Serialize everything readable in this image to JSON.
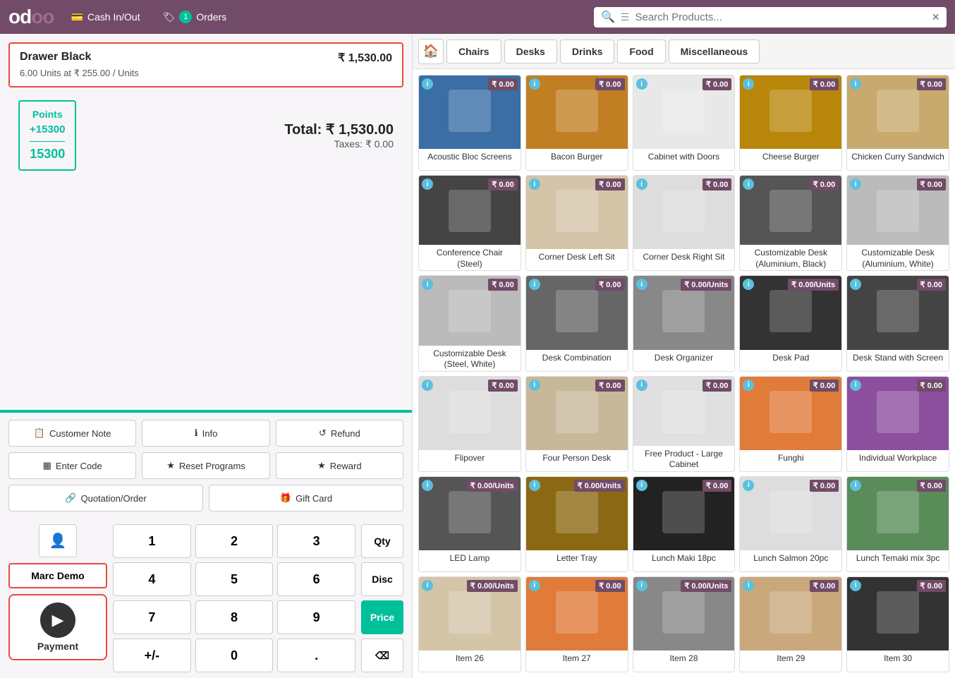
{
  "topbar": {
    "logo": "odoo",
    "cash_btn": "Cash In/Out",
    "orders_btn": "Orders",
    "orders_count": "1",
    "search_placeholder": "Search Products...",
    "search_clear": "×"
  },
  "order": {
    "item_name": "Drawer Black",
    "item_price": "₹ 1,530.00",
    "item_detail": "6.00 Units at ₹ 255.00 / Units",
    "points_label": "Points",
    "points_earned": "+15300",
    "points_total": "15300",
    "total_label": "Total:",
    "total_value": "₹ 1,530.00",
    "taxes_label": "Taxes:",
    "taxes_value": "₹ 0.00"
  },
  "actions": {
    "customer_note": "Customer Note",
    "info": "Info",
    "refund": "Refund",
    "enter_code": "Enter Code",
    "reset_programs": "Reset Programs",
    "reward": "Reward",
    "quotation_order": "Quotation/Order",
    "gift_card": "Gift Card"
  },
  "numpad": {
    "customer_name": "Marc Demo",
    "payment_label": "Payment",
    "keys": [
      "1",
      "2",
      "3",
      "4",
      "5",
      "6",
      "7",
      "8",
      "9",
      "+/-",
      "0",
      "."
    ],
    "qty_label": "Qty",
    "disc_label": "Disc",
    "price_label": "Price",
    "backspace": "⌫"
  },
  "categories": {
    "home_icon": "🏠",
    "tabs": [
      "Chairs",
      "Desks",
      "Drinks",
      "Food",
      "Miscellaneous"
    ]
  },
  "products": [
    {
      "name": "Acoustic Bloc Screens",
      "price": "₹ 0.00",
      "color": "img-blue",
      "emoji": "🔵"
    },
    {
      "name": "Bacon Burger",
      "price": "₹ 0.00",
      "color": "img-orange",
      "emoji": "🍔"
    },
    {
      "name": "Cabinet with Doors",
      "price": "₹ 0.00",
      "color": "img-white",
      "emoji": "🗄"
    },
    {
      "name": "Cheese Burger",
      "price": "₹ 0.00",
      "color": "img-brown",
      "emoji": "🍔"
    },
    {
      "name": "Chicken Curry Sandwich",
      "price": "₹ 0.00",
      "color": "img-tan",
      "emoji": "🥪"
    },
    {
      "name": "Conference Chair (Steel)",
      "price": "₹ 0.00",
      "color": "img-black",
      "emoji": "🪑"
    },
    {
      "name": "Corner Desk Left Sit",
      "price": "₹ 0.00",
      "color": "img-beige",
      "emoji": "🪑"
    },
    {
      "name": "Corner Desk Right Sit",
      "price": "₹ 0.00",
      "color": "img-light",
      "emoji": "🖥"
    },
    {
      "name": "Customizable Desk (Aluminium, Black)",
      "price": "₹ 0.00",
      "color": "img-dark",
      "emoji": "🖥"
    },
    {
      "name": "Customizable Desk (Aluminium, White)",
      "price": "₹ 0.00",
      "color": "img-light",
      "emoji": "🖥"
    },
    {
      "name": "Customizable Desk (Steel, White)",
      "price": "₹ 0.00",
      "color": "img-light",
      "emoji": "🖥"
    },
    {
      "name": "Desk Combination",
      "price": "₹ 0.00",
      "color": "img-dark",
      "emoji": "🖥"
    },
    {
      "name": "Desk Organizer",
      "price": "₹ 0.00/Units",
      "color": "img-gray",
      "emoji": "📦"
    },
    {
      "name": "Desk Pad",
      "price": "₹ 0.00/Units",
      "color": "img-black",
      "emoji": "🖱"
    },
    {
      "name": "Desk Stand with Screen",
      "price": "₹ 0.00",
      "color": "img-dark",
      "emoji": "🖥"
    },
    {
      "name": "Flipover",
      "price": "₹ 0.00",
      "color": "img-light",
      "emoji": "📋"
    },
    {
      "name": "Four Person Desk",
      "price": "₹ 0.00",
      "color": "img-beige",
      "emoji": "🪑"
    },
    {
      "name": "Free Product - Large Cabinet",
      "price": "₹ 0.00",
      "color": "img-light",
      "emoji": "🗄"
    },
    {
      "name": "Funghi",
      "price": "₹ 0.00",
      "color": "img-orange",
      "emoji": "🍕"
    },
    {
      "name": "Individual Workplace",
      "price": "₹ 0.00",
      "color": "img-purple",
      "emoji": "🪑"
    },
    {
      "name": "LED Lamp",
      "price": "₹ 0.00/Units",
      "color": "img-black",
      "emoji": "💡"
    },
    {
      "name": "Letter Tray",
      "price": "₹ 0.00/Units",
      "color": "img-brown",
      "emoji": "📥"
    },
    {
      "name": "Lunch Maki 18pc",
      "price": "₹ 0.00",
      "color": "img-dark",
      "emoji": "🍱"
    },
    {
      "name": "Lunch Salmon 20pc",
      "price": "₹ 0.00",
      "color": "img-light",
      "emoji": "🍱"
    },
    {
      "name": "Lunch Temaki mix 3pc",
      "price": "₹ 0.00",
      "color": "img-green",
      "emoji": "🍣"
    },
    {
      "name": "Item 26",
      "price": "₹ 0.00/Units",
      "color": "img-beige",
      "emoji": "📦"
    },
    {
      "name": "Item 27",
      "price": "₹ 0.00",
      "color": "img-orange",
      "emoji": "🥪"
    },
    {
      "name": "Item 28",
      "price": "₹ 0.00/Units",
      "color": "img-gray",
      "emoji": "🪜"
    },
    {
      "name": "Item 29",
      "price": "₹ 0.00",
      "color": "img-tan",
      "emoji": "🪑"
    },
    {
      "name": "Item 30",
      "price": "₹ 0.00",
      "color": "img-black",
      "emoji": "🪑"
    }
  ]
}
